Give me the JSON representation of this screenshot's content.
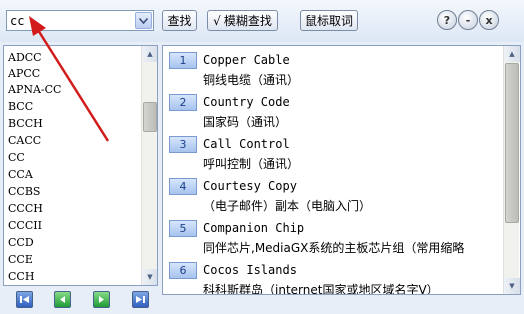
{
  "toolbar": {
    "search_value": "cc",
    "find_label": "查找",
    "fuzzy_check": "√",
    "fuzzy_label": "模糊查找",
    "mouse_label": "鼠标取词",
    "help_icon": "?",
    "min_icon": "-",
    "close_icon": "x"
  },
  "word_list": [
    "ADCC",
    "APCC",
    "APNA-CC",
    "BCC",
    "BCCH",
    "CACC",
    "CC",
    "CCA",
    "CCBS",
    "CCCH",
    "CCCII",
    "CCD",
    "CCE",
    "CCH"
  ],
  "results": [
    {
      "num": "1",
      "en": "Copper Cable",
      "cn": "铜线电缆（通讯）"
    },
    {
      "num": "2",
      "en": "Country Code",
      "cn": "国家码（通讯）"
    },
    {
      "num": "3",
      "en": "Call Control",
      "cn": "呼叫控制（通讯）"
    },
    {
      "num": "4",
      "en": "Courtesy Copy",
      "cn": "（电子邮件）副本（电脑入门）"
    },
    {
      "num": "5",
      "en": "Companion Chip",
      "cn": "同伴芯片,MediaGX系统的主板芯片组（常用缩略"
    },
    {
      "num": "6",
      "en": "Cocos Islands",
      "cn": "科科斯群岛（internet国家或地区域名字V）"
    }
  ],
  "colors": {
    "accent": "#1b3f8a",
    "arrow": "#d21c1c",
    "nav_blue": "#2f5fbf",
    "nav_green": "#1f9a36"
  },
  "icons": {
    "combo": "chevron-down-icon",
    "nav_first": "first-page-icon",
    "nav_prev": "previous-icon",
    "nav_next": "next-icon",
    "nav_last": "last-page-icon"
  }
}
